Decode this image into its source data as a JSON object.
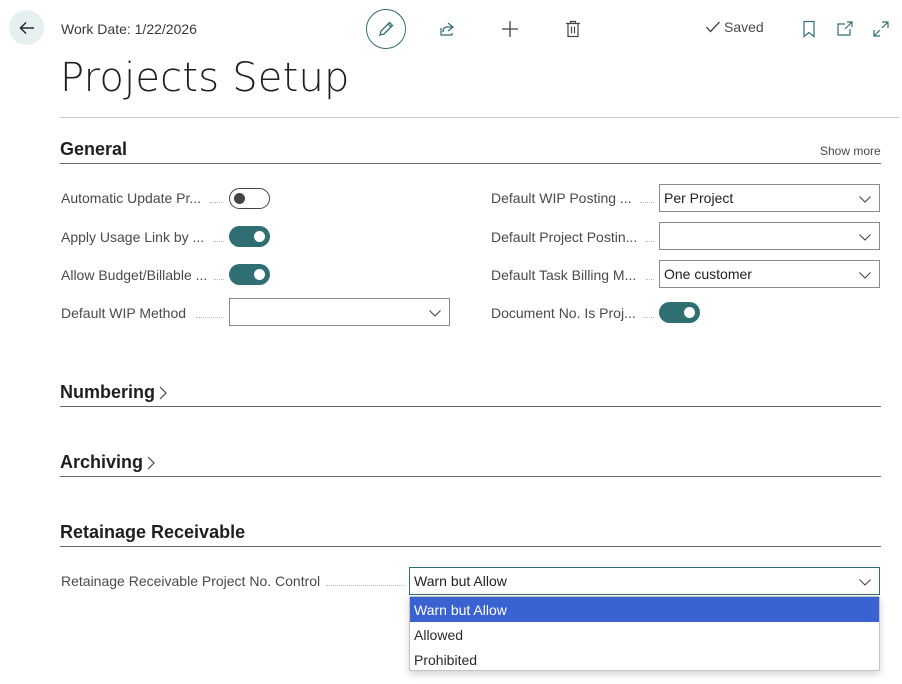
{
  "header": {
    "work_date": "Work Date: 1/22/2026",
    "saved_label": "Saved"
  },
  "page": {
    "title": "Projects Setup"
  },
  "general": {
    "title": "General",
    "show_more": "Show more",
    "fields": {
      "automatic_update": {
        "label": "Automatic Update Pr...",
        "value": false
      },
      "apply_usage_link": {
        "label": "Apply Usage Link by ...",
        "value": true
      },
      "allow_budget": {
        "label": "Allow Budget/Billable ...",
        "value": true
      },
      "default_wip_method": {
        "label": "Default WIP Method",
        "value": ""
      },
      "default_wip_posting": {
        "label": "Default WIP Posting ...",
        "value": "Per Project"
      },
      "default_project_posting": {
        "label": "Default Project Postin...",
        "value": ""
      },
      "default_task_billing": {
        "label": "Default Task Billing M...",
        "value": "One customer"
      },
      "document_no_is_project": {
        "label": "Document No. Is Proj...",
        "value": true
      }
    }
  },
  "numbering": {
    "title": "Numbering"
  },
  "archiving": {
    "title": "Archiving"
  },
  "retainage": {
    "title": "Retainage Receivable",
    "field_label": "Retainage Receivable Project No. Control",
    "value": "Warn but Allow",
    "options": [
      "Warn but Allow",
      "Allowed",
      "Prohibited"
    ]
  },
  "colors": {
    "accent": "#2f6e73",
    "selection": "#3b62d1"
  },
  "icons": {
    "back": "arrow-left-icon",
    "edit": "pencil-icon",
    "share": "share-icon",
    "new": "plus-icon",
    "delete": "trash-icon",
    "saved": "checkmark-icon",
    "bookmark": "bookmark-icon",
    "open_new": "open-new-window-icon",
    "expand": "expand-icon"
  }
}
